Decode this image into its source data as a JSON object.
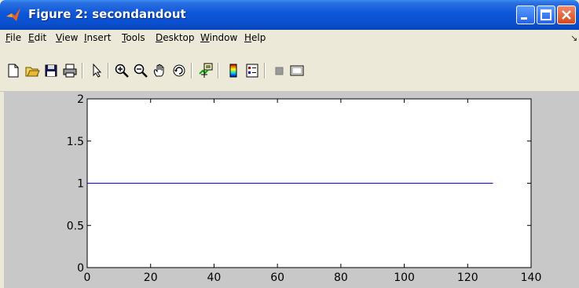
{
  "window": {
    "title": "Figure 2: secondandout",
    "app_icon": "matlab-logo-icon",
    "controls": [
      "minimize-icon",
      "maximize-icon",
      "close-icon"
    ]
  },
  "menubar": {
    "items": [
      "File",
      "Edit",
      "View",
      "Insert",
      "Tools",
      "Desktop",
      "Window",
      "Help"
    ],
    "overflow_icon": "menu-overflow-arrow-icon"
  },
  "toolbar": {
    "buttons": [
      "new-figure-icon",
      "open-file-icon",
      "save-icon",
      "print-icon",
      "edit-plot-arrow-icon",
      "zoom-in-icon",
      "zoom-out-icon",
      "pan-hand-icon",
      "rotate-3d-icon",
      "data-cursor-icon",
      "colorbar-icon",
      "legend-icon",
      "hide-plot-tools-icon",
      "show-plot-tools-icon"
    ]
  },
  "colors": {
    "line": "#0000ff",
    "figure_background": "#c8c8c8",
    "titlebar": "#0a4fcf"
  },
  "chart_data": {
    "type": "line",
    "title": "",
    "xlabel": "",
    "ylabel": "",
    "xlim": [
      0,
      140
    ],
    "ylim": [
      0,
      2
    ],
    "xticks": [
      "0",
      "20",
      "40",
      "60",
      "80",
      "100",
      "120",
      "140"
    ],
    "yticks": [
      "0",
      "0.5",
      "1",
      "1.5",
      "2"
    ],
    "grid": false,
    "series": [
      {
        "x": [
          0,
          128
        ],
        "y": [
          1,
          1
        ]
      }
    ]
  }
}
